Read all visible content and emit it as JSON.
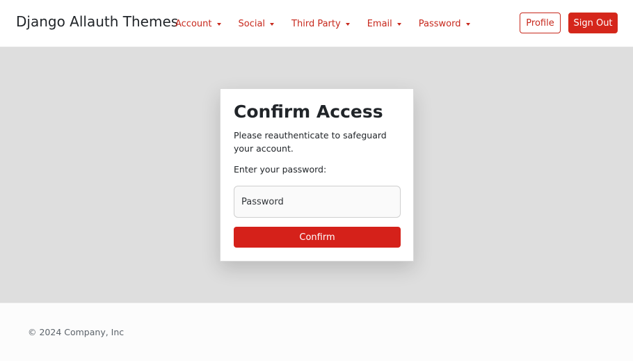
{
  "navbar": {
    "brand": "Django Allauth Themes",
    "links": [
      {
        "label": "Account"
      },
      {
        "label": "Social"
      },
      {
        "label": "Third Party"
      },
      {
        "label": "Email"
      },
      {
        "label": "Password"
      }
    ],
    "profile_label": "Profile",
    "signout_label": "Sign Out"
  },
  "card": {
    "title": "Confirm Access",
    "description": "Please reauthenticate to safeguard your account.",
    "password_label": "Enter your password:",
    "password_placeholder": "Password",
    "password_value": "",
    "confirm_label": "Confirm"
  },
  "footer": {
    "copyright": "© 2024 Company, Inc"
  },
  "colors": {
    "accent": "#d5261b",
    "nav_link": "#c7281c",
    "main_background": "#dedede"
  },
  "icons": {
    "dropdown": "caret-down-icon"
  }
}
